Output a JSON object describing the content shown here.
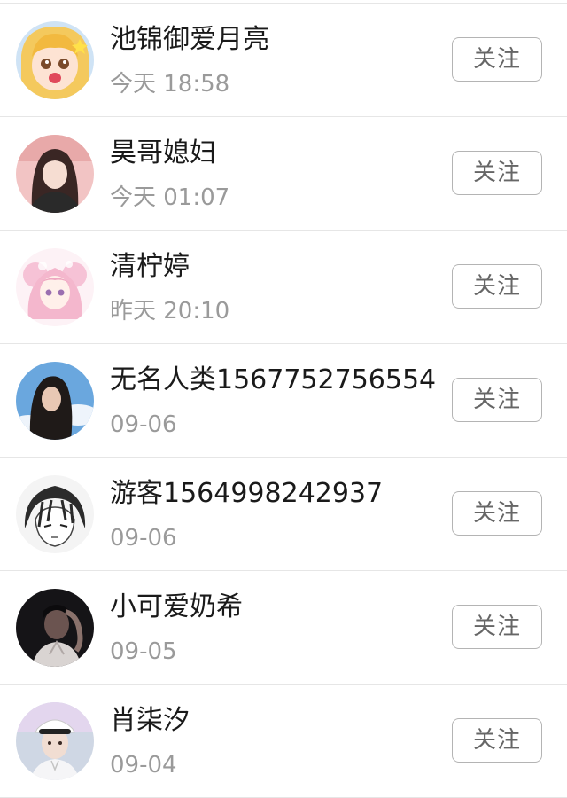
{
  "follow_list": {
    "items": [
      {
        "name": "池锦御爱月亮",
        "time": "今天 18:58",
        "button": "关注",
        "avatar_icon": "anime-girl-avatar-icon"
      },
      {
        "name": "昊哥媳妇",
        "time": "今天 01:07",
        "button": "关注",
        "avatar_icon": "girl-photo-avatar-icon"
      },
      {
        "name": "清柠婷",
        "time": "昨天 20:10",
        "button": "关注",
        "avatar_icon": "pink-anime-avatar-icon"
      },
      {
        "name": "无名人类1567752756554",
        "time": "09-06",
        "button": "关注",
        "avatar_icon": "sky-girl-avatar-icon"
      },
      {
        "name": "游客1564998242937",
        "time": "09-06",
        "button": "关注",
        "avatar_icon": "manga-boy-avatar-icon"
      },
      {
        "name": "小可爱奶希",
        "time": "09-05",
        "button": "关注",
        "avatar_icon": "dark-photo-avatar-icon"
      },
      {
        "name": "肖柒汐",
        "time": "09-04",
        "button": "关注",
        "avatar_icon": "boy-cap-avatar-icon"
      }
    ]
  },
  "colors": {
    "name_text": "#1a1a1a",
    "time_text": "#9a9a9a",
    "button_border": "#b4b4b4",
    "button_text": "#666666",
    "divider": "#e6e6e6"
  }
}
